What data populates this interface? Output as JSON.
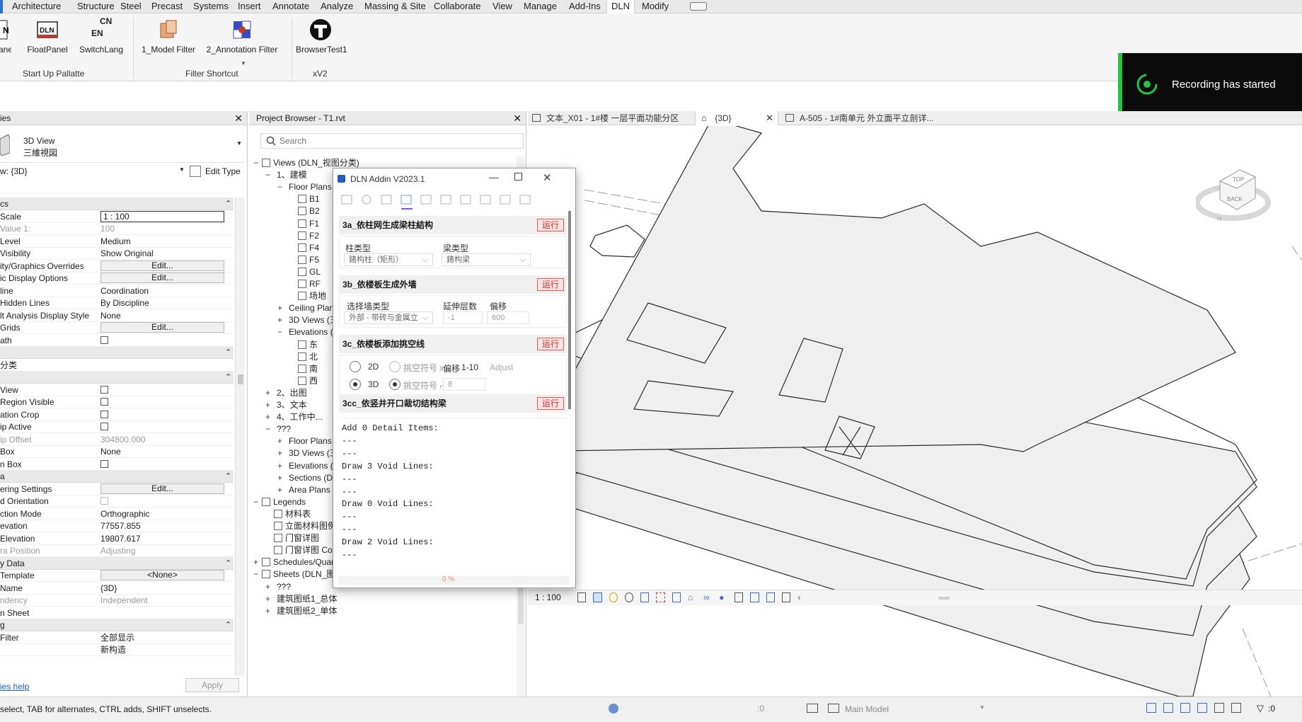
{
  "ribbon_tabs": [
    "Architecture",
    "Structure",
    "Steel",
    "Precast",
    "Systems",
    "Insert",
    "Annotate",
    "Analyze",
    "Massing & Site",
    "Collaborate",
    "View",
    "Manage",
    "Add-Ins",
    "DLN",
    "Modify"
  ],
  "ribbon": {
    "partial_first": "anel",
    "buttons": [
      "FloatPanel",
      "SwitchLang",
      "1_Model Filter",
      "2_Annotation Filter",
      "BrowserTest1"
    ],
    "switchlang_icon_text": [
      "CN",
      "EN"
    ],
    "panels": [
      "Start Up Pallatte",
      "Filter Shortcut",
      "xV2"
    ]
  },
  "toast": {
    "text": "Recording has started"
  },
  "properties": {
    "header": "ies",
    "type_line1": "3D View",
    "type_line2": "三維視図",
    "selector": "w: {3D}",
    "edit_type": "Edit Type",
    "rows": [
      {
        "k": "cs",
        "v": "",
        "kind": "sec"
      },
      {
        "k": "Scale",
        "v": "1 : 100",
        "kind": "input"
      },
      {
        "k": "Value  1:",
        "v": "100",
        "kind": "dis"
      },
      {
        "k": "Level",
        "v": "Medium",
        "kind": "text"
      },
      {
        "k": "Visibility",
        "v": "Show Original",
        "kind": "text"
      },
      {
        "k": "ity/Graphics Overrides",
        "v": "Edit...",
        "kind": "btn"
      },
      {
        "k": "ic Display Options",
        "v": "Edit...",
        "kind": "btn"
      },
      {
        "k": "line",
        "v": "Coordination",
        "kind": "text"
      },
      {
        "k": "Hidden Lines",
        "v": "By Discipline",
        "kind": "text"
      },
      {
        "k": "lt Analysis Display Style",
        "v": "None",
        "kind": "text"
      },
      {
        "k": "Grids",
        "v": "Edit...",
        "kind": "btn"
      },
      {
        "k": "ath",
        "v": "",
        "kind": "check"
      },
      {
        "k": "",
        "v": "",
        "kind": "sec"
      },
      {
        "k": "分类",
        "v": "",
        "kind": "text"
      },
      {
        "k": "",
        "v": "",
        "kind": "sec"
      },
      {
        "k": "View",
        "v": "",
        "kind": "check"
      },
      {
        "k": "Region Visible",
        "v": "",
        "kind": "check"
      },
      {
        "k": "ation Crop",
        "v": "",
        "kind": "check"
      },
      {
        "k": "ip Active",
        "v": "",
        "kind": "check"
      },
      {
        "k": "ip Offset",
        "v": "304800.000",
        "kind": "dis"
      },
      {
        "k": "Box",
        "v": "None",
        "kind": "text"
      },
      {
        "k": "n Box",
        "v": "",
        "kind": "check"
      },
      {
        "k": "a",
        "v": "",
        "kind": "sec"
      },
      {
        "k": "ering Settings",
        "v": "Edit...",
        "kind": "btn"
      },
      {
        "k": "d Orientation",
        "v": "",
        "kind": "disbox"
      },
      {
        "k": "ction Mode",
        "v": "Orthographic",
        "kind": "text"
      },
      {
        "k": "evation",
        "v": "77557.855",
        "kind": "text"
      },
      {
        "k": "Elevation",
        "v": "19807.617",
        "kind": "text"
      },
      {
        "k": "ra Position",
        "v": "Adjusting",
        "kind": "dis"
      },
      {
        "k": "y Data",
        "v": "",
        "kind": "sec"
      },
      {
        "k": "Template",
        "v": "<None>",
        "kind": "btn"
      },
      {
        "k": "Name",
        "v": "{3D}",
        "kind": "text"
      },
      {
        "k": "ndency",
        "v": "Independent",
        "kind": "dis"
      },
      {
        "k": "n Sheet",
        "v": "",
        "kind": "text"
      },
      {
        "k": "g",
        "v": "",
        "kind": "sec"
      },
      {
        "k": "Filter",
        "v": "全部显示",
        "kind": "text"
      },
      {
        "k": "",
        "v": "新构造",
        "kind": "text"
      }
    ],
    "help": "ies help",
    "apply": "Apply"
  },
  "project_browser": {
    "title": "Project Browser - T1.rvt",
    "search_placeholder": "Search",
    "rows": [
      {
        "ind": 0,
        "exp": "−",
        "icon": true,
        "t": "Views (DLN_视图分类)"
      },
      {
        "ind": 1,
        "exp": "−",
        "icon": false,
        "t": "1、建模"
      },
      {
        "ind": 2,
        "exp": "−",
        "icon": false,
        "t": "Floor Plans"
      },
      {
        "ind": 3,
        "exp": "",
        "icon": true,
        "t": "B1"
      },
      {
        "ind": 3,
        "exp": "",
        "icon": true,
        "t": "B2"
      },
      {
        "ind": 3,
        "exp": "",
        "icon": true,
        "t": "F1"
      },
      {
        "ind": 3,
        "exp": "",
        "icon": true,
        "t": "F2"
      },
      {
        "ind": 3,
        "exp": "",
        "icon": true,
        "t": "F4"
      },
      {
        "ind": 3,
        "exp": "",
        "icon": true,
        "t": "F5"
      },
      {
        "ind": 3,
        "exp": "",
        "icon": true,
        "t": "GL"
      },
      {
        "ind": 3,
        "exp": "",
        "icon": true,
        "t": "RF"
      },
      {
        "ind": 3,
        "exp": "",
        "icon": true,
        "t": "场地"
      },
      {
        "ind": 2,
        "exp": "+",
        "icon": false,
        "t": "Ceiling Plan"
      },
      {
        "ind": 2,
        "exp": "+",
        "icon": false,
        "t": "3D Views (三"
      },
      {
        "ind": 2,
        "exp": "−",
        "icon": false,
        "t": "Elevations ("
      },
      {
        "ind": 3,
        "exp": "",
        "icon": true,
        "t": "东"
      },
      {
        "ind": 3,
        "exp": "",
        "icon": true,
        "t": "北"
      },
      {
        "ind": 3,
        "exp": "",
        "icon": true,
        "t": "南"
      },
      {
        "ind": 3,
        "exp": "",
        "icon": true,
        "t": "西"
      },
      {
        "ind": 1,
        "exp": "+",
        "icon": false,
        "t": "2、出图"
      },
      {
        "ind": 1,
        "exp": "+",
        "icon": false,
        "t": "3、文本"
      },
      {
        "ind": 1,
        "exp": "+",
        "icon": false,
        "t": "4、工作中..."
      },
      {
        "ind": 1,
        "exp": "−",
        "icon": false,
        "t": "???"
      },
      {
        "ind": 2,
        "exp": "+",
        "icon": false,
        "t": "Floor Plans"
      },
      {
        "ind": 2,
        "exp": "+",
        "icon": false,
        "t": "3D Views (三"
      },
      {
        "ind": 2,
        "exp": "+",
        "icon": false,
        "t": "Elevations ("
      },
      {
        "ind": 2,
        "exp": "+",
        "icon": false,
        "t": "Sections (D"
      },
      {
        "ind": 2,
        "exp": "+",
        "icon": false,
        "t": "Area Plans ("
      },
      {
        "ind": 0,
        "exp": "−",
        "icon": true,
        "t": "Legends"
      },
      {
        "ind": 1,
        "exp": "",
        "icon": true,
        "t": "材料表"
      },
      {
        "ind": 1,
        "exp": "",
        "icon": true,
        "t": "立面材料图例"
      },
      {
        "ind": 1,
        "exp": "",
        "icon": true,
        "t": "门窗详图"
      },
      {
        "ind": 1,
        "exp": "",
        "icon": true,
        "t": "门窗详图 Copy 1"
      },
      {
        "ind": 0,
        "exp": "+",
        "icon": true,
        "t": "Schedules/Quantities (DLN_明细表分类)"
      },
      {
        "ind": 0,
        "exp": "−",
        "icon": true,
        "t": "Sheets (DLN_图纸分类)"
      },
      {
        "ind": 1,
        "exp": "+",
        "icon": false,
        "t": "???"
      },
      {
        "ind": 1,
        "exp": "+",
        "icon": false,
        "t": "建筑图纸1_总体"
      },
      {
        "ind": 1,
        "exp": "+",
        "icon": false,
        "t": "建筑图纸2_单体"
      }
    ]
  },
  "view_tabs": [
    {
      "label": "文本_X01 - 1#楼 一层平面功能分区",
      "close": false
    },
    {
      "label": "{3D}",
      "close": true
    },
    {
      "label": "A-505 - 1#南单元 外立面平立剖详...",
      "close": false
    }
  ],
  "view_cube": {
    "top": "TOP",
    "back": "BACK",
    "n": "N"
  },
  "dialog": {
    "title": "DLN Addin V2023.1",
    "s1": {
      "title": "3a_依柱网生成梁柱結构",
      "run": "运行",
      "col_label": "柱类型",
      "col_value": "鍺构柱（矩形）",
      "beam_label": "梁类型",
      "beam_value": "鍺构梁"
    },
    "s2": {
      "title": "3b_依楼板生成外墙",
      "run": "运行",
      "wall_label": "选择墙类型",
      "wall_value": "外部 - 带砖与金属立",
      "levels_label": "延伸层数",
      "levels_value": "-1",
      "offset_label": "偏移",
      "offset_value": "600"
    },
    "s3": {
      "title": "3c_依楼板添加挑空线",
      "run": "运行",
      "r2d": "2D",
      "r3d": "3D",
      "sym_x": "挑空符号 x",
      "sym_v": "挑空符号 ⌐",
      "offset_label": "偏移",
      "offset_range": "1-10",
      "adjust": "Adjust",
      "offset_value": "8"
    },
    "s4": {
      "title": "3cc_依竖井开口裁切结构梁",
      "run": "运行"
    },
    "log": [
      "Add 0 Detail Items:",
      "---",
      "---",
      "Draw 3 Void Lines:",
      "---",
      "---",
      "Draw 0 Void Lines:",
      "---",
      "---",
      "Draw 2 Void Lines:",
      "---"
    ],
    "progress": "0 %"
  },
  "status": {
    "left": "select, TAB for alternates, CTRL adds, SHIFT unselects.",
    "scale": "1 : 100",
    "zero1": ":0",
    "model": "Main Model",
    "zero2": ":0"
  }
}
